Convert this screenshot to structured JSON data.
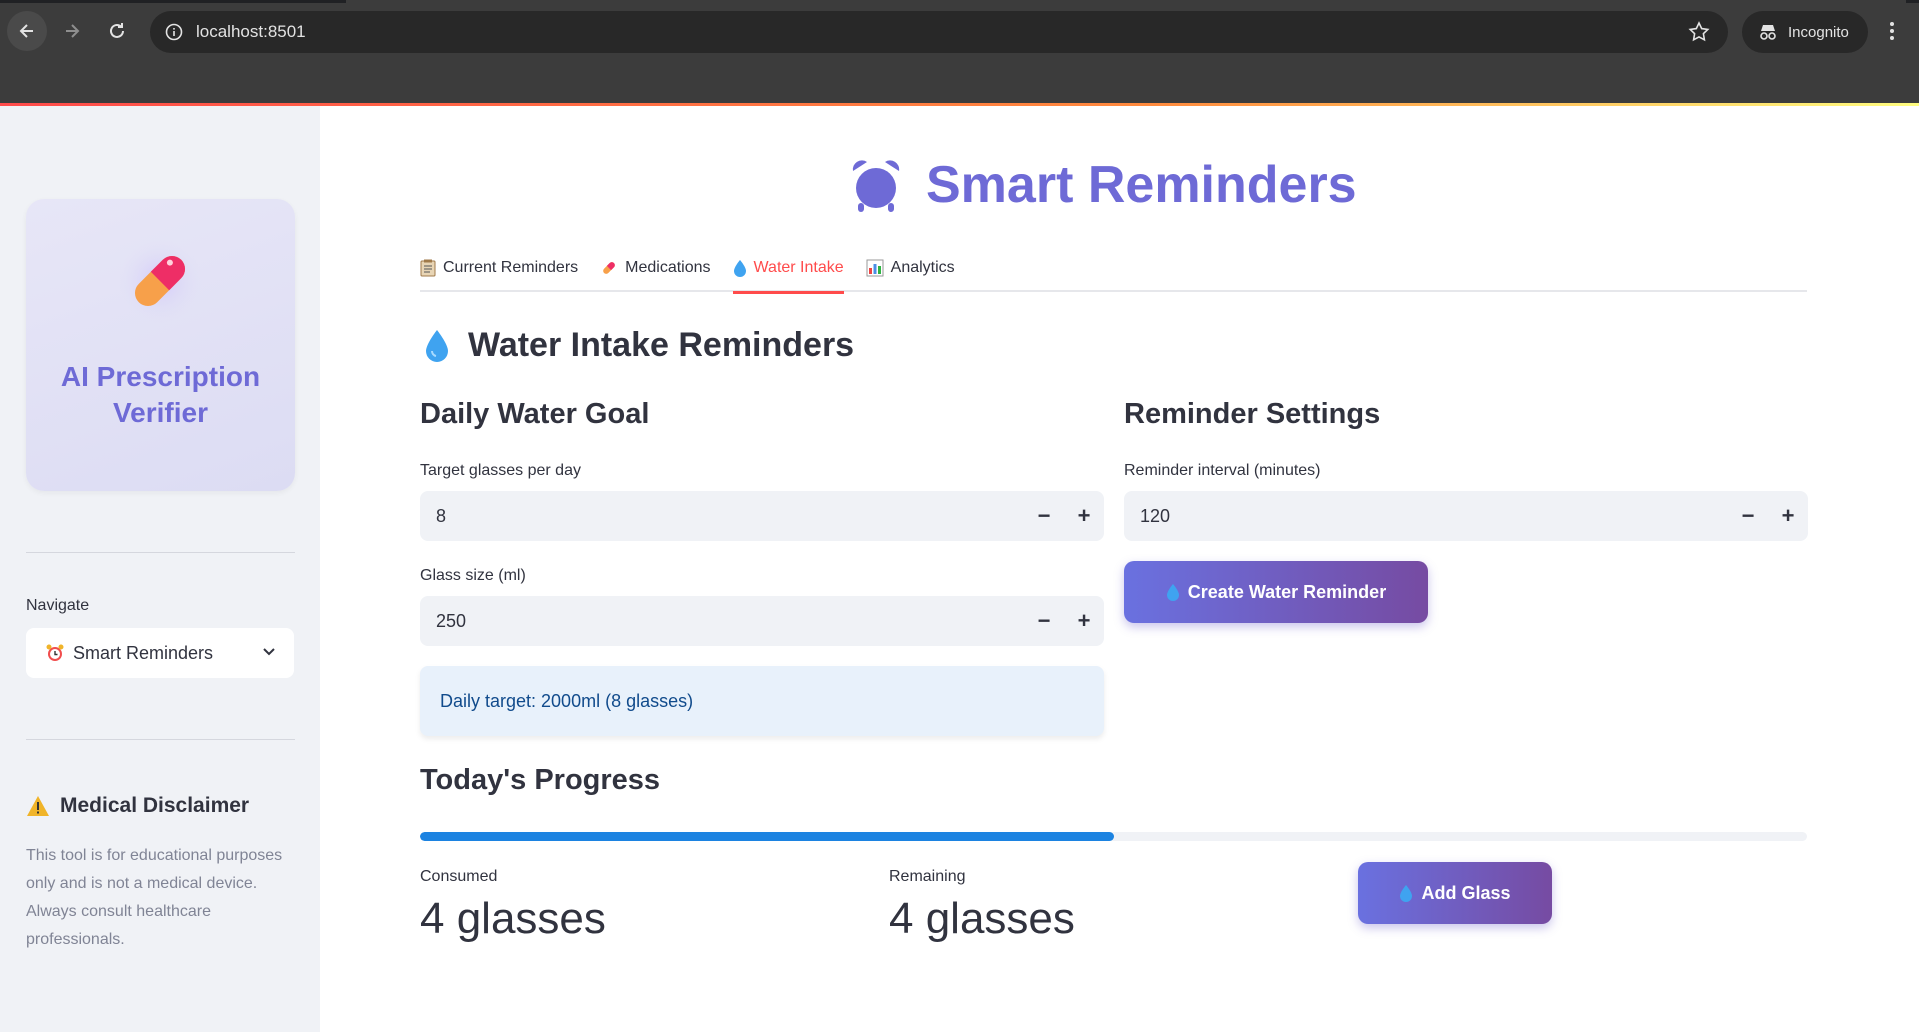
{
  "browser": {
    "url": "localhost:8501",
    "profile_label": "Incognito",
    "icons": [
      "back-arrow-icon",
      "forward-arrow-icon",
      "reload-icon",
      "site-info-icon",
      "bookmark-star-icon",
      "incognito-icon",
      "menu-dots-icon"
    ]
  },
  "sidebar": {
    "brand_title": "AI Prescription Verifier",
    "brand_icon": "pill-icon",
    "nav_label": "Navigate",
    "nav_selected": "Smart Reminders",
    "nav_selected_icon": "alarm-clock-icon",
    "disclaimer_title": "Medical Disclaimer",
    "disclaimer_text": "This tool is for educational purposes only and is not a medical device. Always consult healthcare professionals."
  },
  "main": {
    "page_title": "Smart Reminders",
    "tabs": [
      {
        "label": "Current Reminders",
        "icon": "clipboard-icon"
      },
      {
        "label": "Medications",
        "icon": "pill-icon"
      },
      {
        "label": "Water Intake",
        "icon": "water-drop-icon",
        "active": true
      },
      {
        "label": "Analytics",
        "icon": "bar-chart-icon"
      }
    ],
    "section_title": "Water Intake Reminders",
    "goal": {
      "title": "Daily Water Goal",
      "glasses_label": "Target glasses per day",
      "glasses_value": "8",
      "size_label": "Glass size (ml)",
      "size_value": "250",
      "info": "Daily target: 2000ml (8 glasses)"
    },
    "settings": {
      "title": "Reminder Settings",
      "interval_label": "Reminder interval (minutes)",
      "interval_value": "120",
      "create_button": "Create Water Reminder"
    },
    "progress": {
      "title": "Today's Progress",
      "fraction": 0.5,
      "consumed_label": "Consumed",
      "consumed_value": "4 glasses",
      "remaining_label": "Remaining",
      "remaining_value": "4 glasses",
      "add_button": "Add Glass"
    },
    "stepper": {
      "minus": "−",
      "plus": "+"
    }
  },
  "colors": {
    "accent": "#6e6ad6",
    "tab_active": "#ff4b4b",
    "progress": "#1c83e1",
    "button_gradient_start": "#6a71e0",
    "button_gradient_end": "#764ba2",
    "info_bg": "#e8f1fb",
    "info_text": "#114b8c"
  }
}
